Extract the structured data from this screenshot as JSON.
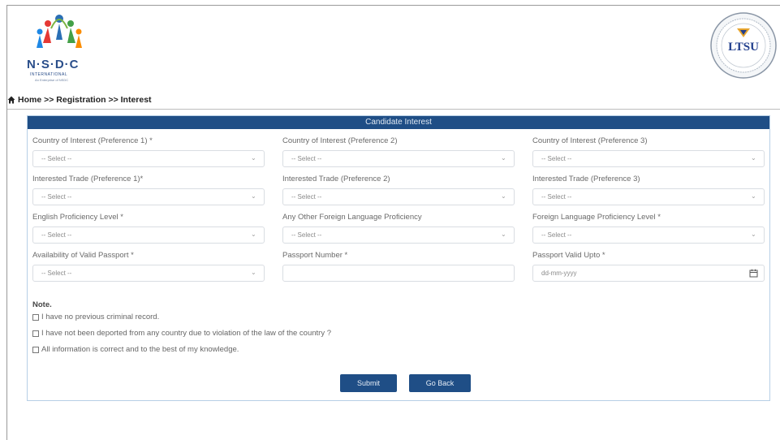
{
  "header": {
    "left_logo": {
      "name": "N·S·D·C",
      "subtitle": "INTERNATIONAL",
      "tagline": "An Enterprise of NSDC"
    },
    "right_logo": {
      "name": "LTSU"
    }
  },
  "breadcrumb": {
    "text": "Home >> Registration >> Interest"
  },
  "form": {
    "title": "Candidate Interest",
    "fields": [
      {
        "label": "Country of Interest (Preference 1) *",
        "value": "-- Select --",
        "type": "select"
      },
      {
        "label": "Country of Interest (Preference 2)",
        "value": "-- Select --",
        "type": "select"
      },
      {
        "label": "Country of Interest (Preference 3)",
        "value": "-- Select --",
        "type": "select"
      },
      {
        "label": "Interested Trade (Preference 1)*",
        "value": "-- Select --",
        "type": "select"
      },
      {
        "label": "Interested Trade (Preference 2)",
        "value": "-- Select --",
        "type": "select"
      },
      {
        "label": "Interested Trade (Preference 3)",
        "value": "-- Select --",
        "type": "select"
      },
      {
        "label": "English Proficiency Level *",
        "value": "-- Select --",
        "type": "select"
      },
      {
        "label": "Any Other Foreign Language Proficiency",
        "value": "-- Select --",
        "type": "select"
      },
      {
        "label": "Foreign Language Proficiency Level *",
        "value": "-- Select --",
        "type": "select"
      },
      {
        "label": "Availability of Valid Passport *",
        "value": "-- Select --",
        "type": "select"
      },
      {
        "label": "Passport Number *",
        "value": "",
        "type": "input"
      },
      {
        "label": "Passport Valid Upto *",
        "value": "dd-mm-yyyy",
        "type": "date"
      }
    ],
    "note_label": "Note.",
    "checkboxes": [
      "I have no previous criminal record.",
      "I have not been deported from any country due to violation of the law of the country ?",
      "All information is correct and to the best of my knowledge."
    ],
    "submit_label": "Submit",
    "goback_label": "Go Back"
  },
  "colors": {
    "accent": "#1f4e86",
    "border": "#b7cfe6"
  }
}
